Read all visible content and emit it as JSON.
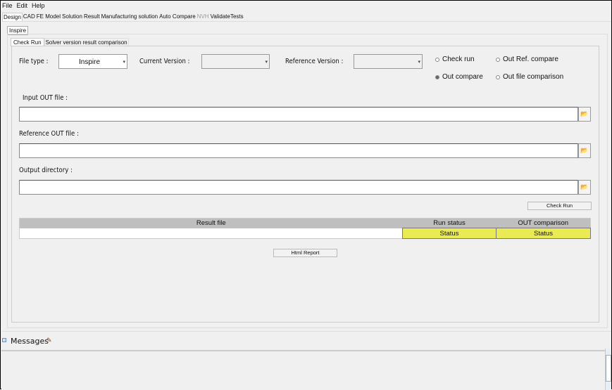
{
  "menu": [
    "File",
    "Edit",
    "Help"
  ],
  "tabs": [
    {
      "label": "Design",
      "active": true
    },
    {
      "label": "CAD"
    },
    {
      "label": "FE Model"
    },
    {
      "label": "Solution"
    },
    {
      "label": "Result"
    },
    {
      "label": "Manufacturing solution"
    },
    {
      "label": "Auto Compare"
    },
    {
      "label": "NVH",
      "disabled": true
    },
    {
      "label": "ValidateTests"
    }
  ],
  "subtab": "Inspire",
  "inner_tabs": [
    "Check Run",
    "Solver version result comparison"
  ],
  "form": {
    "file_type_label": "File type :",
    "file_type_value": "Inspire",
    "current_version_label": "Current Version  :",
    "current_version_value": "",
    "reference_version_label": "Reference Version :",
    "reference_version_value": "",
    "radios": [
      {
        "label": "Check run",
        "checked": false
      },
      {
        "label": "Out Ref. compare",
        "checked": false
      },
      {
        "label": "Out compare",
        "checked": true
      },
      {
        "label": "Out file comparison",
        "checked": false
      }
    ],
    "input_out_label": "Input OUT file :",
    "input_out_value": "",
    "reference_out_label": "Reference OUT file :",
    "reference_out_value": "",
    "output_dir_label": "Output directory :",
    "output_dir_value": "",
    "check_run_button": "Check Run",
    "html_report_button": "Html Report"
  },
  "table": {
    "headers": [
      "Result file",
      "Run status",
      "OUT comparison"
    ],
    "rows": [
      [
        "",
        "Status",
        "Status"
      ]
    ],
    "status_color": "#eaea55"
  },
  "messages": {
    "label": "Messages",
    "checked": true
  }
}
